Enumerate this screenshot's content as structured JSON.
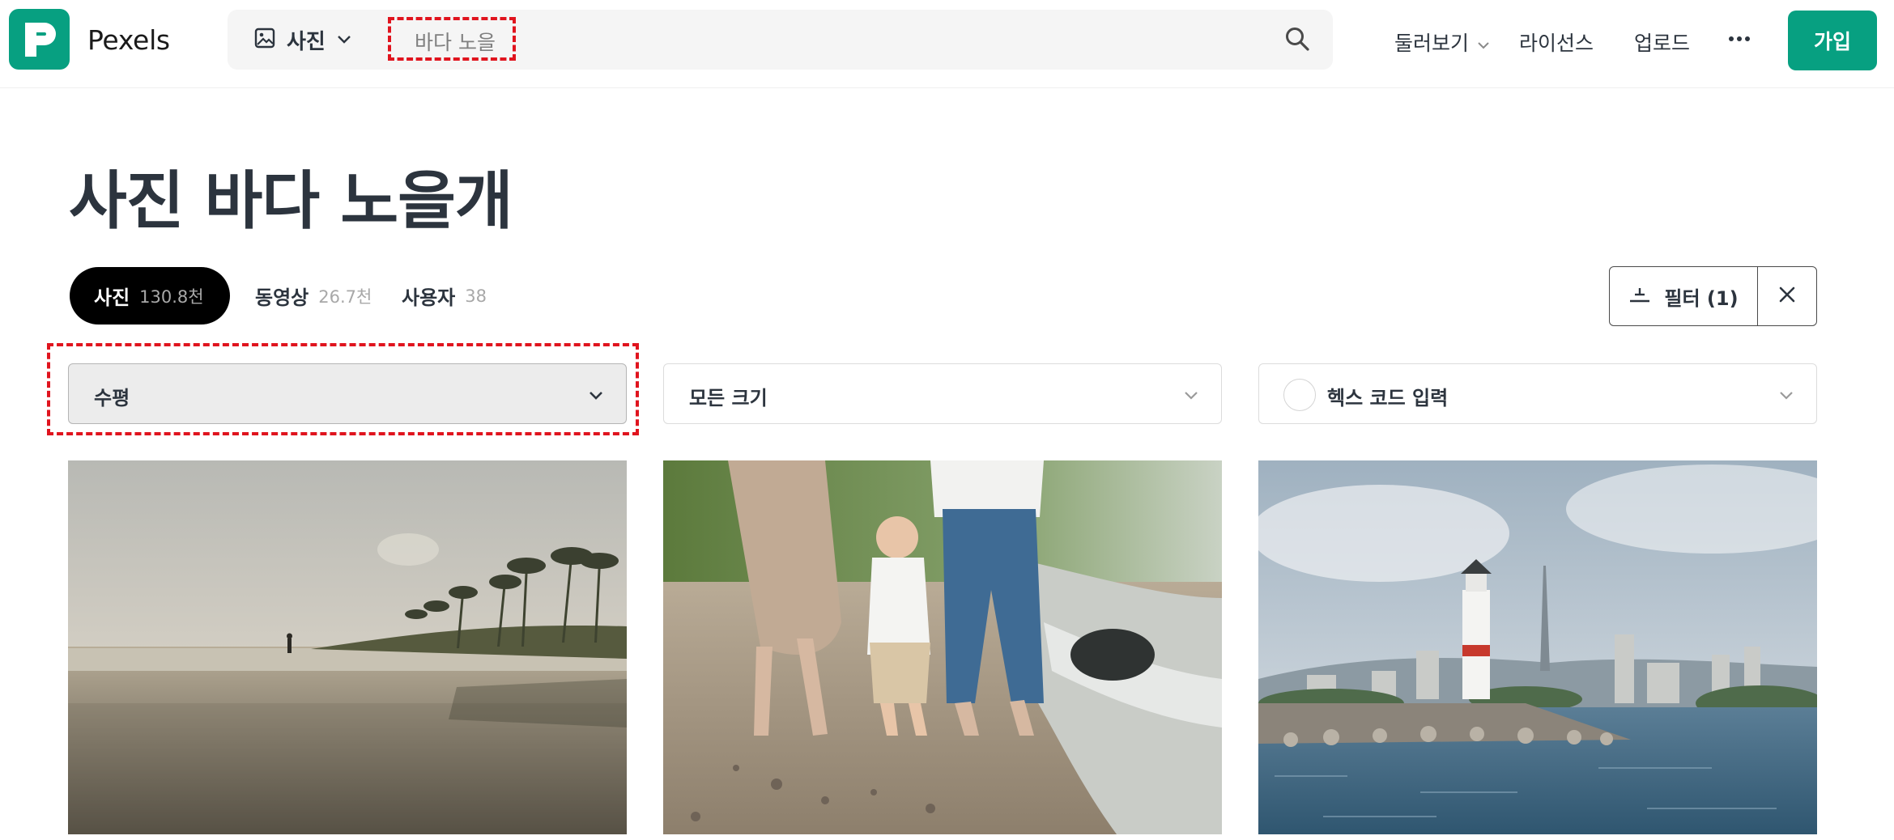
{
  "header": {
    "brand": "Pexels",
    "search": {
      "type_label": "사진",
      "query": "바다 노을"
    },
    "nav": {
      "explore": "둘러보기",
      "license": "라이선스",
      "upload": "업로드",
      "join": "가입"
    }
  },
  "page": {
    "title": "사진 바다 노을개"
  },
  "tabs": [
    {
      "label": "사진",
      "count": "130.8천",
      "active": true
    },
    {
      "label": "동영상",
      "count": "26.7천",
      "active": false
    },
    {
      "label": "사용자",
      "count": "38",
      "active": false
    }
  ],
  "filters": {
    "filter_button": "필터 (1)",
    "orientation": "수평",
    "size": "모든 크기",
    "color_placeholder": "헥스 코드 입력"
  },
  "colors": {
    "brand": "#07a081",
    "highlight": "#e0141e",
    "text": "#2c343e"
  },
  "icons": [
    "pexels-logo",
    "image-icon",
    "chevron-down-icon",
    "search-icon",
    "more-icon",
    "filter-icon",
    "close-icon"
  ]
}
